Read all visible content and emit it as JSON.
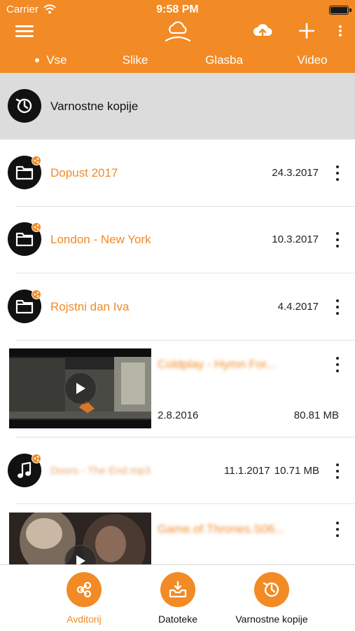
{
  "status_bar": {
    "carrier": "Carrier",
    "time": "9:58 PM"
  },
  "tabs": [
    {
      "label": "Vse",
      "active": true
    },
    {
      "label": "Slike",
      "active": false
    },
    {
      "label": "Glasba",
      "active": false
    },
    {
      "label": "Video",
      "active": false
    }
  ],
  "backup_row": {
    "label": "Varnostne kopije",
    "icon": "history-icon"
  },
  "albums": [
    {
      "title": "Dopust 2017",
      "date": "24.3.2017",
      "icon": "folder-icon"
    },
    {
      "title": "London - New York",
      "date": "10.3.2017",
      "icon": "folder-icon"
    },
    {
      "title": "Rojstni dan Iva",
      "date": "4.4.2017",
      "icon": "folder-icon"
    }
  ],
  "files": [
    {
      "type": "video",
      "title": "Coldplay - Hymn For...",
      "date": "2.8.2016",
      "size": "80.81 MB"
    },
    {
      "type": "audio",
      "title": "Doors - The End.mp3",
      "date": "11.1.2017",
      "size": "10.71 MB"
    },
    {
      "type": "video",
      "title": "Game.of.Thrones.S06..."
    }
  ],
  "bottom_tabs": [
    {
      "label": "Avditorij",
      "icon": "share-nodes-icon",
      "active": true
    },
    {
      "label": "Datoteke",
      "icon": "inbox-tray-icon",
      "active": false
    },
    {
      "label": "Varnostne kopije",
      "icon": "history-icon",
      "active": false
    }
  ],
  "colors": {
    "accent": "#f28a25",
    "header_text": "#ffffff",
    "selected_row_bg": "#dcdcdc",
    "icon_circle": "#111111"
  }
}
